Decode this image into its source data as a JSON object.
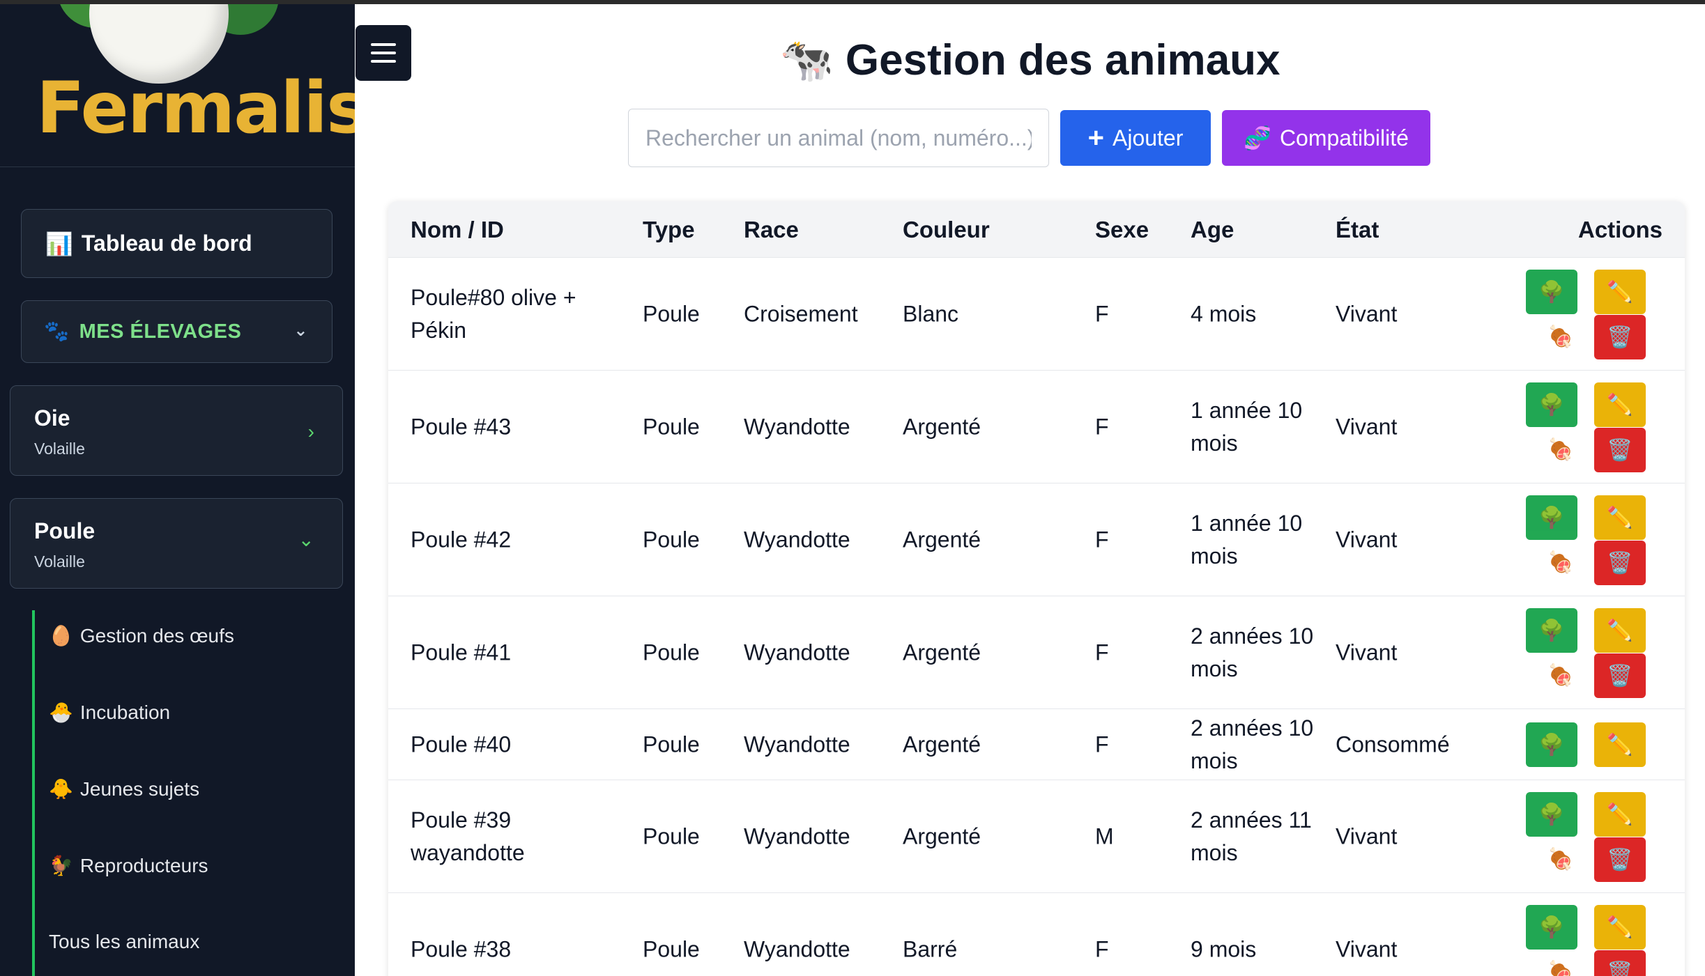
{
  "sidebar": {
    "logo_text": "Fermalis",
    "dashboard": {
      "icon": "📊",
      "label": "Tableau de bord"
    },
    "elevages": {
      "icon": "🐾",
      "label": "MES ÉLEVAGES",
      "chevron": "⌄"
    },
    "species": [
      {
        "name": "Oie",
        "category": "Volaille",
        "chevron": "›"
      },
      {
        "name": "Poule",
        "category": "Volaille",
        "chevron": "⌄"
      }
    ],
    "submenu": [
      {
        "icon": "🥚",
        "label": "Gestion des œufs"
      },
      {
        "icon": "🐣",
        "label": "Incubation"
      },
      {
        "icon": "🐥",
        "label": "Jeunes sujets"
      },
      {
        "icon": "🐓",
        "label": "Reproducteurs"
      },
      {
        "icon": "",
        "label": "Tous les animaux"
      }
    ]
  },
  "header": {
    "title": "🐄 Gestion des animaux",
    "search_placeholder": "Rechercher un animal (nom, numéro...)",
    "add_icon": "+",
    "add_label": "Ajouter",
    "compat_icon": "🧬",
    "compat_label": "Compatibilité"
  },
  "table": {
    "columns": [
      "Nom / ID",
      "Type",
      "Race",
      "Couleur",
      "Sexe",
      "Age",
      "État",
      "Actions"
    ],
    "action_icons": {
      "tree": "🌳",
      "edit": "✏️",
      "meat": "🍖",
      "delete": "🗑️"
    },
    "rows": [
      {
        "name": "Poule#80 olive + Pékin",
        "type": "Poule",
        "race": "Croisement",
        "color": "Blanc",
        "sex": "F",
        "age": "4 mois",
        "state": "Vivant"
      },
      {
        "name": "Poule #43",
        "type": "Poule",
        "race": "Wyandotte",
        "color": "Argenté",
        "sex": "F",
        "age": "1 année 10 mois",
        "state": "Vivant"
      },
      {
        "name": "Poule #42",
        "type": "Poule",
        "race": "Wyandotte",
        "color": "Argenté",
        "sex": "F",
        "age": "1 année 10 mois",
        "state": "Vivant"
      },
      {
        "name": "Poule #41",
        "type": "Poule",
        "race": "Wyandotte",
        "color": "Argenté",
        "sex": "F",
        "age": "2 années 10 mois",
        "state": "Vivant"
      },
      {
        "name": "Poule #40",
        "type": "Poule",
        "race": "Wyandotte",
        "color": "Argenté",
        "sex": "F",
        "age": "2 années 10 mois",
        "state": "Consommé"
      },
      {
        "name": "Poule #39 wayandotte",
        "type": "Poule",
        "race": "Wyandotte",
        "color": "Argenté",
        "sex": "M",
        "age": "2 années 11 mois",
        "state": "Vivant"
      },
      {
        "name": "Poule #38",
        "type": "Poule",
        "race": "Wyandotte",
        "color": "Barré",
        "sex": "F",
        "age": "9 mois",
        "state": "Vivant"
      }
    ]
  },
  "colors": {
    "sidebar_bg": "#111827",
    "accent_green": "#22c55e",
    "logo_gold": "#e8b334",
    "add_blue": "#2563eb",
    "compat_purple": "#9333ea"
  }
}
